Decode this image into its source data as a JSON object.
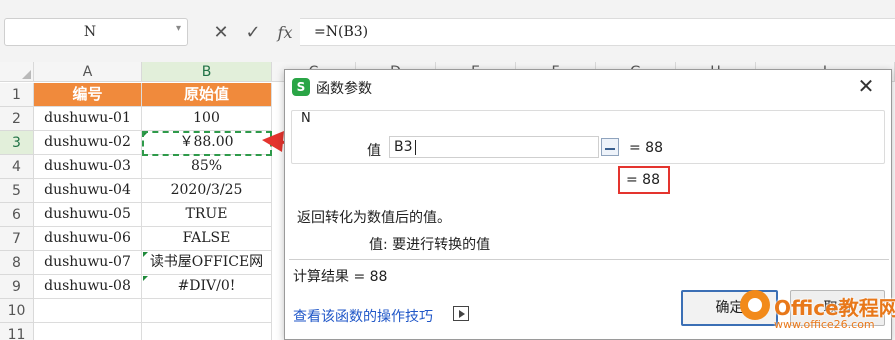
{
  "formula_bar": {
    "name_box": "N",
    "icons": [
      "close-icon",
      "check-icon",
      "fx-icon"
    ],
    "cancel_glyph": "✕",
    "enter_glyph": "✓",
    "fx_label": "fx",
    "formula": "=N(B3)"
  },
  "columns": [
    "A",
    "B",
    "C",
    "D",
    "E",
    "F",
    "G",
    "H",
    "I"
  ],
  "rows": [
    "1",
    "2",
    "3",
    "4",
    "5",
    "6",
    "7",
    "8",
    "9",
    "10",
    "11"
  ],
  "table": {
    "headers": [
      "编号",
      "原始值"
    ],
    "rows": [
      [
        "dushuwu-01",
        "100"
      ],
      [
        "dushuwu-02",
        "￥88.00"
      ],
      [
        "dushuwu-03",
        "85%"
      ],
      [
        "dushuwu-04",
        "2020/3/25"
      ],
      [
        "dushuwu-05",
        "TRUE"
      ],
      [
        "dushuwu-06",
        "FALSE"
      ],
      [
        "dushuwu-07",
        "读书屋OFFICE网"
      ],
      [
        "dushuwu-08",
        "#DIV/0!"
      ]
    ]
  },
  "dialog": {
    "app_icon": "S",
    "title": "函数参数",
    "function_name": "N",
    "param_label": "值",
    "param_value": "B3",
    "param_result": "= 88",
    "highlight_result": "= 88",
    "description": "返回转化为数值后的值。",
    "param_description": "值:  要进行转换的值",
    "calc_result": "计算结果 = 88",
    "help_link": "查看该函数的操作技巧",
    "ok_label": "确定",
    "cancel_label": "取消"
  },
  "watermark": {
    "main": "Office教程网",
    "sub": "www.office26.com"
  },
  "colors": {
    "header_fill": "#f08a3c",
    "selection_green": "#2e9a4a",
    "arrow_red": "#e4342e",
    "link_blue": "#2057c8"
  }
}
